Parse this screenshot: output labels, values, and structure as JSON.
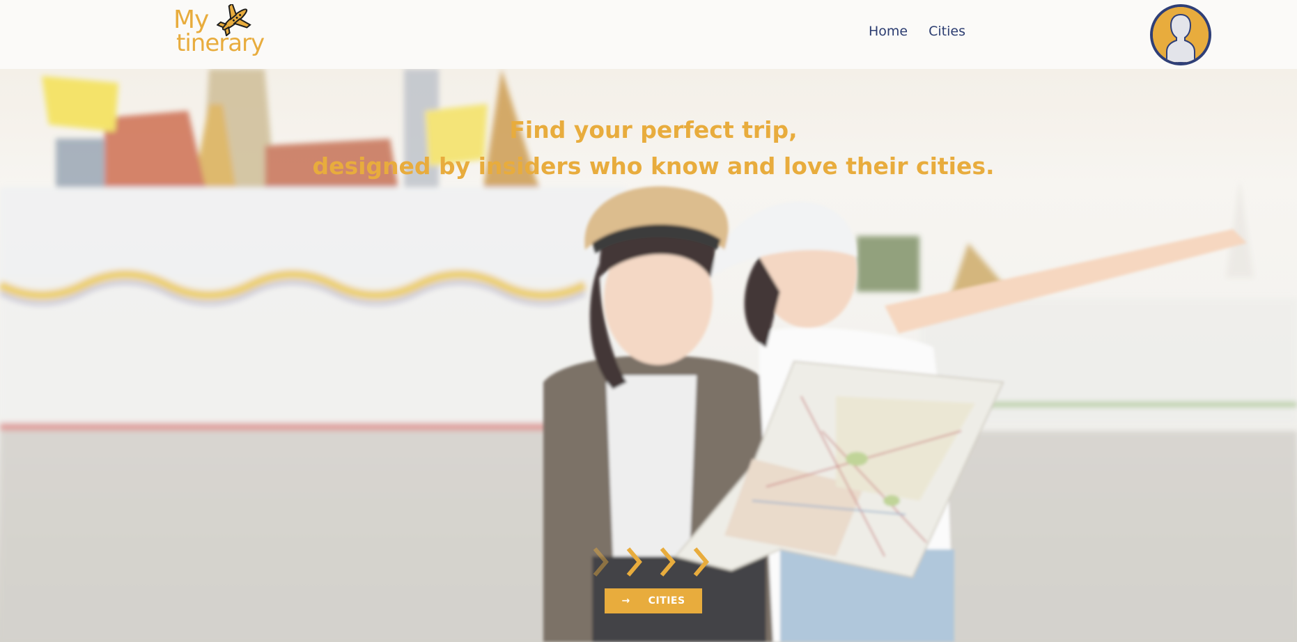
{
  "header": {
    "logo": {
      "text_my": "My",
      "text_tinerary": "tinerary",
      "icon": "airplane-icon"
    },
    "nav": [
      {
        "label": "Home"
      },
      {
        "label": "Cities"
      }
    ],
    "avatar_icon": "user-avatar-icon"
  },
  "hero": {
    "headline_line1": "Find your perfect trip,",
    "headline_line2": "designed by insiders who know and love their cities.",
    "chevrons_icon": "chevron-right-icon",
    "button_label": "CITIES",
    "button_icon": "arrow-right-icon"
  },
  "colors": {
    "accent": "#e8ac3d",
    "nav_text": "#2b3c70",
    "avatar_border": "#2f3f77",
    "header_bg": "#fbfaf8"
  }
}
